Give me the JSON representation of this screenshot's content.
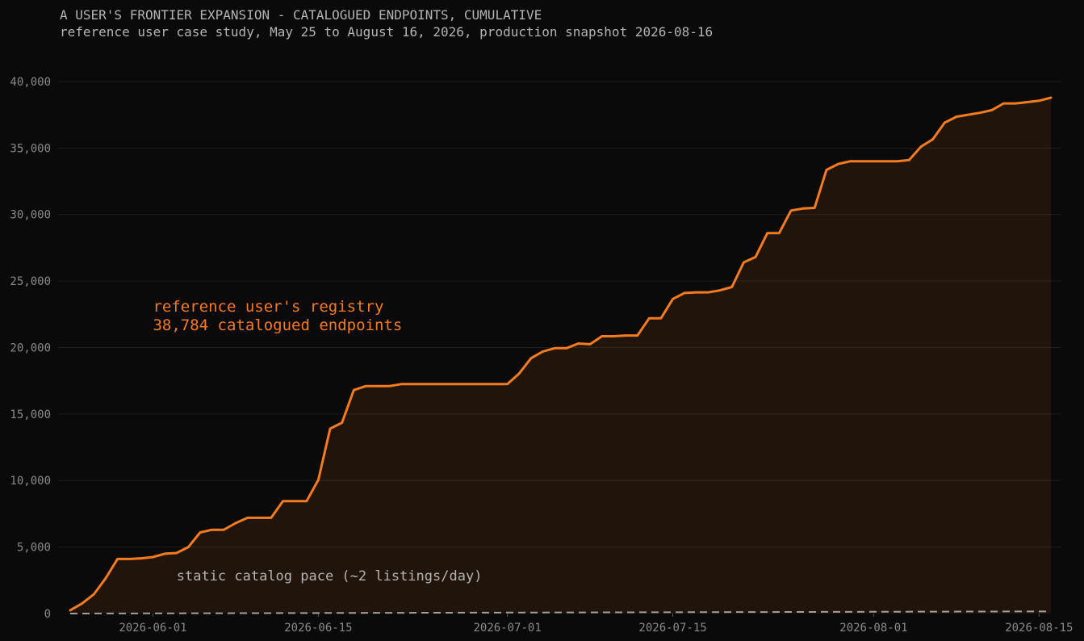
{
  "chart_data": {
    "type": "area",
    "title": "A USER'S FRONTIER EXPANSION - CATALOGUED ENDPOINTS, CUMULATIVE",
    "subtitle": "reference user case study, May 25 to August 16, 2026, production snapshot 2026-08-16",
    "ylim": [
      0,
      42000
    ],
    "xlim": [
      "2026-05-25",
      "2026-08-16"
    ],
    "y_ticks": [
      0,
      5000,
      10000,
      15000,
      20000,
      25000,
      30000,
      35000,
      40000
    ],
    "y_tick_labels": [
      "0",
      "5,000",
      "10,000",
      "15,000",
      "20,000",
      "25,000",
      "30,000",
      "35,000",
      "40,000"
    ],
    "x_ticks": [
      "2026-06-01",
      "2026-06-15",
      "2026-07-01",
      "2026-07-15",
      "2026-08-01",
      "2026-08-15"
    ],
    "grid": "horizontal",
    "colors": {
      "registry": "#f47b20",
      "static": "#a0a0a0",
      "background": "#0a0a0a"
    },
    "annotations": [
      {
        "lines": [
          "reference user's registry",
          "38,784 catalogued endpoints"
        ],
        "anchor": [
          "2026-06-01",
          22700
        ],
        "color": "#f47b20"
      },
      {
        "lines": [
          "static catalog pace (~2 listings/day)"
        ],
        "anchor": [
          "2026-06-03",
          2500
        ],
        "color": "#b4b4b4"
      }
    ],
    "series": [
      {
        "name": "reference user's registry",
        "style": "solid",
        "x": [
          "2026-05-25",
          "2026-05-26",
          "2026-05-27",
          "2026-05-28",
          "2026-05-29",
          "2026-05-30",
          "2026-05-31",
          "2026-06-01",
          "2026-06-02",
          "2026-06-03",
          "2026-06-04",
          "2026-06-05",
          "2026-06-06",
          "2026-06-07",
          "2026-06-08",
          "2026-06-09",
          "2026-06-10",
          "2026-06-11",
          "2026-06-12",
          "2026-06-13",
          "2026-06-14",
          "2026-06-15",
          "2026-06-16",
          "2026-06-17",
          "2026-06-18",
          "2026-06-19",
          "2026-06-20",
          "2026-06-21",
          "2026-06-22",
          "2026-06-23",
          "2026-06-24",
          "2026-06-25",
          "2026-06-26",
          "2026-06-27",
          "2026-06-28",
          "2026-06-29",
          "2026-06-30",
          "2026-07-01",
          "2026-07-02",
          "2026-07-03",
          "2026-07-04",
          "2026-07-05",
          "2026-07-06",
          "2026-07-07",
          "2026-07-08",
          "2026-07-09",
          "2026-07-10",
          "2026-07-11",
          "2026-07-12",
          "2026-07-13",
          "2026-07-14",
          "2026-07-15",
          "2026-07-16",
          "2026-07-17",
          "2026-07-18",
          "2026-07-19",
          "2026-07-20",
          "2026-07-21",
          "2026-07-22",
          "2026-07-23",
          "2026-07-24",
          "2026-07-25",
          "2026-07-26",
          "2026-07-27",
          "2026-07-28",
          "2026-07-29",
          "2026-07-30",
          "2026-07-31",
          "2026-08-01",
          "2026-08-02",
          "2026-08-03",
          "2026-08-04",
          "2026-08-05",
          "2026-08-06",
          "2026-08-07",
          "2026-08-08",
          "2026-08-09",
          "2026-08-10",
          "2026-08-11",
          "2026-08-12",
          "2026-08-13",
          "2026-08-14",
          "2026-08-15",
          "2026-08-16"
        ],
        "values": [
          250,
          750,
          1450,
          2650,
          4100,
          4100,
          4150,
          4250,
          4500,
          4550,
          5000,
          6100,
          6300,
          6300,
          6800,
          7200,
          7200,
          7200,
          8450,
          8450,
          8450,
          10050,
          13900,
          14350,
          16800,
          17100,
          17100,
          17100,
          17250,
          17250,
          17250,
          17250,
          17250,
          17250,
          17250,
          17250,
          17250,
          17250,
          18050,
          19200,
          19700,
          19950,
          19950,
          20300,
          20250,
          20850,
          20850,
          20900,
          20900,
          22200,
          22200,
          23650,
          24100,
          24150,
          24150,
          24300,
          24550,
          26400,
          26800,
          28600,
          28600,
          30300,
          30450,
          30500,
          33350,
          33800,
          34000,
          34000,
          34000,
          34000,
          34000,
          34100,
          35100,
          35650,
          36900,
          37350,
          37500,
          37650,
          37850,
          38350,
          38350,
          38450,
          38550,
          38784
        ]
      },
      {
        "name": "static catalog pace (~2 listings/day)",
        "style": "dashed",
        "x": [
          "2026-05-25",
          "2026-08-16"
        ],
        "values": [
          0,
          164
        ]
      }
    ]
  }
}
